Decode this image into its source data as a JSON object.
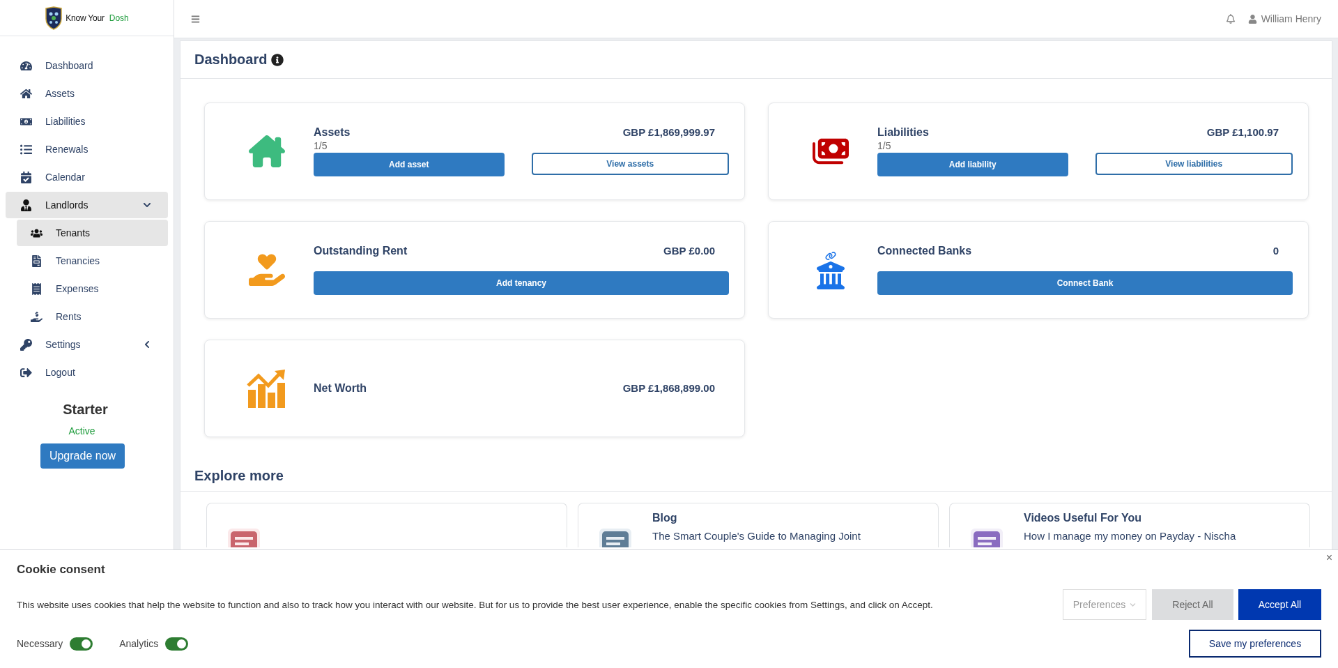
{
  "brand": {
    "prefix": "Know Your",
    "accent": "Dosh"
  },
  "sidebar": {
    "items": [
      {
        "label": "Dashboard",
        "selected": false
      },
      {
        "label": "Assets",
        "selected": false
      },
      {
        "label": "Liabilities",
        "selected": false
      },
      {
        "label": "Renewals",
        "selected": false
      },
      {
        "label": "Calendar",
        "selected": false
      },
      {
        "label": "Landlords",
        "selected": true,
        "expanded": true,
        "children": [
          {
            "label": "Tenants",
            "selected": true
          },
          {
            "label": "Tenancies",
            "selected": false
          },
          {
            "label": "Expenses",
            "selected": false
          },
          {
            "label": "Rents",
            "selected": false
          }
        ]
      },
      {
        "label": "Settings",
        "selected": false,
        "expanded": false
      },
      {
        "label": "Logout",
        "selected": false
      }
    ]
  },
  "plan": {
    "name": "Starter",
    "status": "Active",
    "button": "Upgrade now"
  },
  "topbar": {
    "user": "William Henry"
  },
  "dashboard": {
    "title": "Dashboard",
    "cards": [
      {
        "kind": "dual",
        "title": "Assets",
        "amount": "GBP £1,869,999.97",
        "count": "1/5",
        "primary": "Add asset",
        "secondary": "View assets"
      },
      {
        "kind": "dual",
        "title": "Liabilities",
        "amount": "GBP £1,100.97",
        "count": "1/5",
        "primary": "Add liability",
        "secondary": "View liabilities"
      },
      {
        "kind": "single",
        "title": "Outstanding Rent",
        "amount": "GBP £0.00",
        "primary": "Add tenancy"
      },
      {
        "kind": "single",
        "title": "Connected Banks",
        "amount": "0",
        "primary": "Connect Bank"
      },
      {
        "kind": "plain",
        "title": "Net Worth",
        "amount": "GBP £1,868,899.00"
      }
    ]
  },
  "explore": {
    "title": "Explore more",
    "items": [
      {
        "kind": "untitled"
      },
      {
        "kind": "titled",
        "title": "Blog",
        "subtitle": "The Smart Couple's Guide to Managing Joint"
      },
      {
        "kind": "titled",
        "title": "Videos Useful For You",
        "subtitle": "How I manage my money on Payday - Nischa"
      }
    ]
  },
  "cookie": {
    "title": "Cookie consent",
    "text": "This website uses cookies that help the website to function and also to track how you interact with our website. But for us to provide the best user experience, enable the specific cookies from Settings, and click on Accept.",
    "close": "×",
    "preferences": "Preferences",
    "reject": "Reject All",
    "accept": "Accept All",
    "save": "Save my preferences",
    "toggles": [
      {
        "label": "Necessary",
        "on": true
      },
      {
        "label": "Analytics",
        "on": true
      }
    ]
  }
}
